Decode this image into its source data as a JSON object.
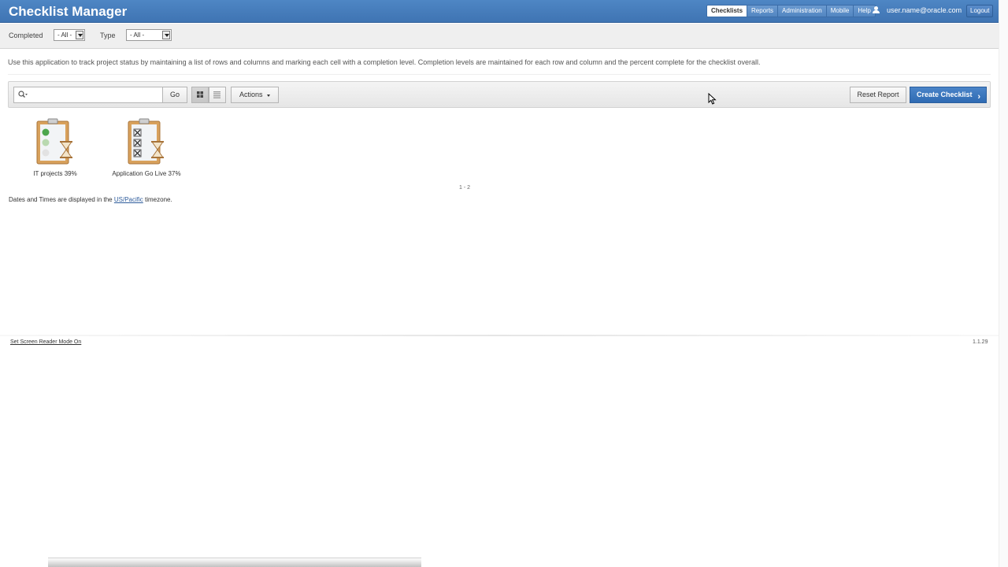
{
  "header": {
    "app_title": "Checklist Manager",
    "tabs": [
      {
        "label": "Checklists",
        "active": true
      },
      {
        "label": "Reports",
        "active": false
      },
      {
        "label": "Administration",
        "active": false
      },
      {
        "label": "Mobile",
        "active": false
      },
      {
        "label": "Help",
        "active": false
      }
    ],
    "user_name": "user.name@oracle.com",
    "logout_label": "Logout"
  },
  "filters": {
    "completed_label": "Completed",
    "completed_value": "- All -",
    "type_label": "Type",
    "type_value": "- All -"
  },
  "description": "Use this application to track project status by maintaining a list of rows and columns and marking each cell with a completion level. Completion levels are maintained for each row and column and the percent complete for the checklist overall.",
  "toolbar": {
    "search_placeholder": "",
    "go_label": "Go",
    "actions_label": "Actions",
    "reset_label": "Reset Report",
    "create_label": "Create Checklist"
  },
  "checklists": [
    {
      "label": "IT projects 39%",
      "icon": "clipboard-status-icon"
    },
    {
      "label": "Application Go Live 37%",
      "icon": "clipboard-crossed-icon"
    }
  ],
  "pagination": "1 - 2",
  "timezone": {
    "prefix": "Dates and Times are displayed in the",
    "link": "US/Pacific",
    "suffix": "timezone."
  },
  "footer": {
    "screen_reader_label": "Set Screen Reader Mode On",
    "version": "1.1.29"
  },
  "colors": {
    "header_blue": "#4e86c4",
    "primary_button": "#2f6bb3"
  }
}
